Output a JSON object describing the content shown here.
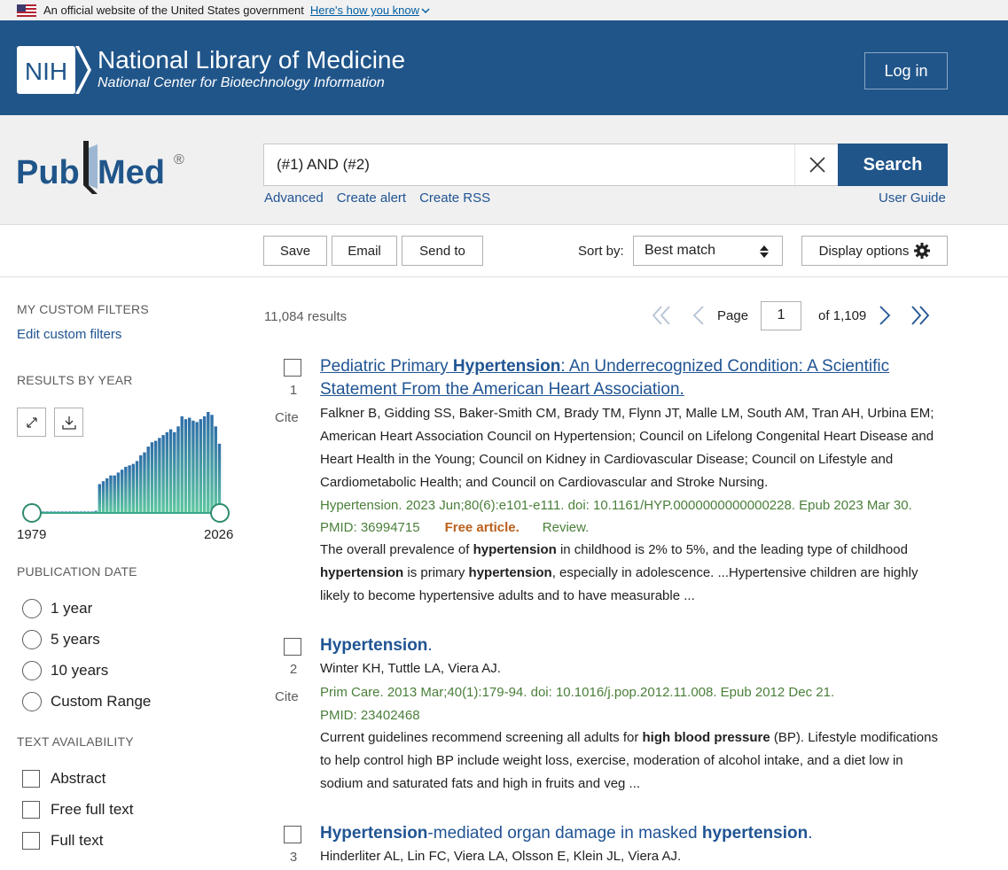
{
  "gov_banner": {
    "text": "An official website of the United States government",
    "link": "Here's how you know"
  },
  "header": {
    "logo_text": "NIH",
    "title": "National Library of Medicine",
    "subtitle": "National Center for Biotechnology Information",
    "login": "Log in"
  },
  "pubmed": {
    "logo_left": "Pub",
    "logo_right": "Med",
    "registered": "®"
  },
  "search": {
    "query": "(#1) AND (#2)",
    "button": "Search",
    "links": [
      "Advanced",
      "Create alert",
      "Create RSS"
    ],
    "user_guide": "User Guide"
  },
  "actions": {
    "save": "Save",
    "email": "Email",
    "send_to": "Send to",
    "sort_label": "Sort by:",
    "sort_value": "Best match",
    "display": "Display options"
  },
  "sidebar": {
    "custom_filters_heading": "MY CUSTOM FILTERS",
    "edit_filters": "Edit custom filters",
    "results_by_year_heading": "RESULTS BY YEAR",
    "year_start": "1979",
    "year_end": "2026",
    "year_counts": [
      2,
      2,
      2,
      2,
      2,
      2,
      2,
      2,
      2,
      2,
      2,
      2,
      2,
      2,
      2,
      3,
      40,
      44,
      48,
      52,
      52,
      56,
      60,
      64,
      66,
      68,
      72,
      80,
      84,
      92,
      98,
      100,
      104,
      108,
      112,
      116,
      112,
      120,
      134,
      130,
      132,
      128,
      126,
      130,
      134,
      140,
      136,
      120,
      96
    ],
    "publication_date_heading": "PUBLICATION DATE",
    "date_options": [
      "1 year",
      "5 years",
      "10 years",
      "Custom Range"
    ],
    "text_availability_heading": "TEXT AVAILABILITY",
    "text_options": [
      "Abstract",
      "Free full text",
      "Full text"
    ]
  },
  "results": {
    "count": "11,084 results",
    "page_label": "Page",
    "page": "1",
    "page_of": "of 1,109",
    "cite": "Cite",
    "items": [
      {
        "num": "1",
        "title_parts": [
          "Pediatric Primary ",
          "Hypertension",
          ": An Underrecognized Condition: A Scientific"
        ],
        "title_line2": "Statement From the American Heart Association.",
        "authors": "Falkner B, Gidding SS, Baker-Smith CM, Brady TM, Flynn JT, Malle LM, South AM, Tran AH, Urbina EM; American Heart Association Council on Hypertension; Council on Lifelong Congenital Heart Disease and Heart Health in the Young; Council on Kidney in Cardiovascular Disease; Council on Lifestyle and Cardiometabolic Health; and Council on Cardiovascular and Stroke Nursing.",
        "citation": "Hypertension. 2023 Jun;80(6):e101-e111. doi: 10.1161/HYP.0000000000000228. Epub 2023 Mar 30.",
        "pmid": "PMID: 36994715",
        "free": "Free article.",
        "review": "Review.",
        "snippet": [
          [
            "The overall prevalence of ",
            false
          ],
          [
            "hypertension",
            true
          ],
          [
            " in childhood is 2% to 5%, and the leading type of childhood ",
            false
          ],
          [
            "hypertension",
            true
          ],
          [
            " is primary ",
            false
          ],
          [
            "hypertension",
            true
          ],
          [
            ", especially in adolescence. ...Hypertensive children are highly likely to become hypertensive adults and to have measurable ...",
            false
          ]
        ]
      },
      {
        "num": "2",
        "title_parts": [
          "Hypertension",
          "."
        ],
        "authors": "Winter KH, Tuttle LA, Viera AJ.",
        "citation": "Prim Care. 2013 Mar;40(1):179-94. doi: 10.1016/j.pop.2012.11.008. Epub 2012 Dec 21.",
        "pmid": "PMID: 23402468",
        "snippet": [
          [
            "Current guidelines recommend screening all adults for ",
            false
          ],
          [
            "high blood pressure",
            true
          ],
          [
            " (BP). Lifestyle modifications to help control high BP include weight loss, exercise, moderation of alcohol intake, and a diet low in sodium and saturated fats and high in fruits and veg ...",
            false
          ]
        ]
      },
      {
        "num": "3",
        "title_parts": [
          "Hypertension",
          "-mediated organ damage in masked ",
          "hypertension",
          "."
        ],
        "authors": "Hinderliter AL, Lin FC, Viera LA, Olsson E, Klein JL, Viera AJ."
      }
    ]
  },
  "colors": {
    "nih_blue": "#20558a",
    "link_blue": "#205493",
    "green": "#4a7f3a",
    "free_orange": "#bc5f1a"
  }
}
